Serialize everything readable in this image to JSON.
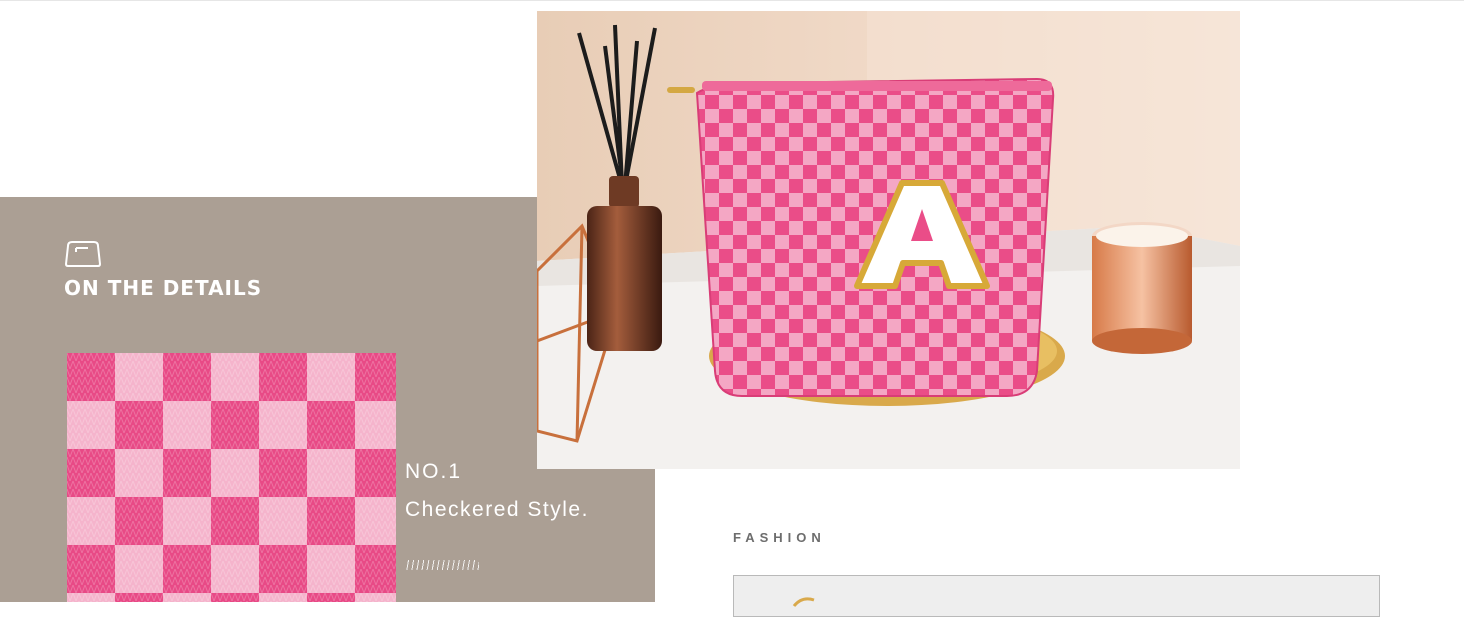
{
  "details": {
    "icon": "bag-icon",
    "title": "ON THE DETAILS"
  },
  "feature": {
    "number": "NO.1",
    "title": "Checkered Style."
  },
  "fashion": {
    "label": "FASHION"
  },
  "colors": {
    "panel": "#ab9f94",
    "pink_dark": "#e84a86",
    "pink_light": "#f5b4cc",
    "wall": "#efd9c6",
    "table": "#f3f1ef",
    "gold": "#d9a94b",
    "copper": "#c8703c"
  }
}
